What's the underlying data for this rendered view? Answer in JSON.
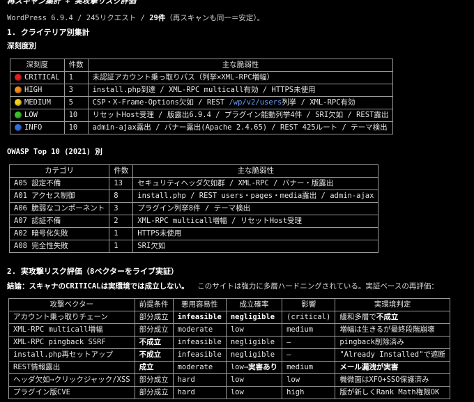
{
  "header": {
    "title": "再スキャン集計 + 実攻撃リスク評価",
    "meta_prefix": "WordPress 6.9.4 / 245リクエスト / ",
    "meta_count": "29件",
    "meta_suffix": "（再スキャンも同一＝安定）。"
  },
  "section1": {
    "heading": "1. クライテリア別集計",
    "severity_label": "深刻度別",
    "severity_table": {
      "headers": [
        "深刻度",
        "件数",
        "主な脆弱性"
      ],
      "rows": [
        {
          "level": "CRITICAL",
          "color": "#e0201f",
          "count": "1",
          "desc": "未認証アカウント乗っ取りパス（列挙×XML-RPC増幅）"
        },
        {
          "level": "HIGH",
          "color": "#f28a1c",
          "count": "3",
          "desc": "install.php到達 / XML-RPC multicall有効 / HTTPS未使用"
        },
        {
          "level": "MEDIUM",
          "color": "#f4d31c",
          "count": "5",
          "desc_a": "CSP・X-Frame-Options欠如 / REST ",
          "desc_link": "/wp/v2/users",
          "desc_b": "列挙 / XML-RPC有効"
        },
        {
          "level": "LOW",
          "color": "#3cbf2e",
          "count": "10",
          "desc": "リセットHost受理 / 版露出6.9.4 / プラグイン能動列挙4件 / SRI欠如 / REST露出"
        },
        {
          "level": "INFO",
          "color": "#2f6fe0",
          "count": "10",
          "desc": "admin-ajax露出 / バナー露出(Apache 2.4.65) / REST 425ルート / テーマ検出"
        }
      ]
    },
    "owasp_label": "OWASP Top 10 (2021) 別",
    "owasp_table": {
      "headers": [
        "カテゴリ",
        "件数",
        "主な脆弱性"
      ],
      "rows": [
        {
          "cat": "A05 設定不備",
          "count": "13",
          "desc": "セキュリティヘッダ欠如群 / XML-RPC / バナー・版露出"
        },
        {
          "cat": "A01 アクセス制御",
          "count": "8",
          "desc": "install.php / REST users・pages・media露出 / admin-ajax"
        },
        {
          "cat": "A06 脆弱なコンポーネント",
          "count": "3",
          "desc": "プラグイン列挙8件 / テーマ検出"
        },
        {
          "cat": "A07 認証不備",
          "count": "2",
          "desc": "XML-RPC multicall増幅 / リセットHost受理"
        },
        {
          "cat": "A02 暗号化失敗",
          "count": "1",
          "desc": "HTTPS未使用"
        },
        {
          "cat": "A08 完全性失敗",
          "count": "1",
          "desc": "SRI欠如"
        }
      ]
    }
  },
  "section2": {
    "heading": "2. 実攻撃リスク評価（8ベクターをライブ実証）",
    "conclusion_bold": "結論：スキャナのCRITICALは実環境では成立しない。",
    "conclusion_rest": "このサイトは強力に多層ハードニングされている。実証ベースの再評価：",
    "attack_table": {
      "headers": [
        "攻撃ベクター",
        "前提条件",
        "悪用容易性",
        "成立確率",
        "影響",
        "実環境判定"
      ],
      "rows": [
        {
          "vector": "アカウント乗っ取りチェーン",
          "pre": "部分成立",
          "ease": "infeasible",
          "ease_bold": true,
          "prob": "negligible",
          "prob_bold": true,
          "impact": "(critical)",
          "verdict_a": "緩和多層で",
          "verdict_b": "不成立"
        },
        {
          "vector": "XML-RPC multicall増幅",
          "pre": "部分成立",
          "ease": "moderate",
          "prob": "low",
          "impact": "medium",
          "verdict": "増幅は生きるが最終段階崩壊"
        },
        {
          "vector": "XML-RPC pingback SSRF",
          "pre": "不成立",
          "pre_bold": true,
          "ease": "infeasible",
          "prob": "negligible",
          "impact": "—",
          "verdict": "pingback削除済み"
        },
        {
          "vector": "install.php再セットアップ",
          "pre": "不成立",
          "pre_bold": true,
          "ease": "infeasible",
          "prob": "negligible",
          "impact": "—",
          "verdict": "\"Already Installed\"で遮断"
        },
        {
          "vector": "REST情報露出",
          "pre": "成立",
          "pre_bold": true,
          "ease": "moderate",
          "prob_a": "low→",
          "prob_b": "実害あり",
          "impact": "medium",
          "verdict": "メール漏洩が実害",
          "verdict_bold": true
        },
        {
          "vector": "ヘッダ欠如→クリックジャック/XSS",
          "pre": "部分成立",
          "ease": "hard",
          "prob": "low",
          "impact": "low",
          "verdict": "機微面はXFO+SSO保護済み"
        },
        {
          "vector": "プラグイン版CVE",
          "pre": "部分成立",
          "ease": "hard",
          "prob": "low",
          "impact": "high",
          "verdict": "版が新しくRank Math権限OK"
        }
      ]
    }
  }
}
